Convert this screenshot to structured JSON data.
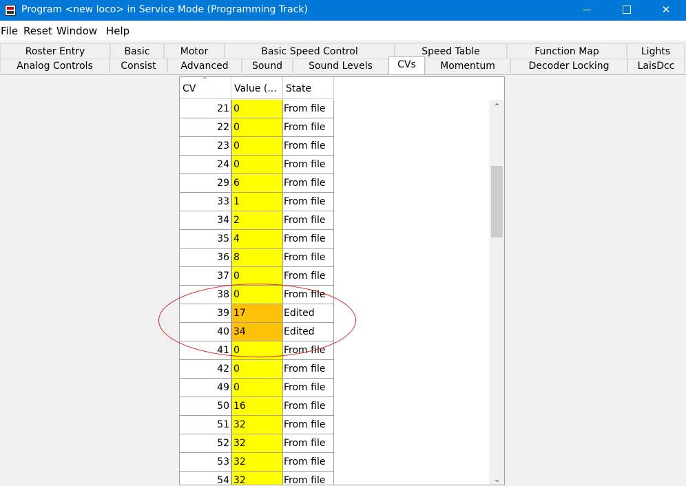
{
  "window": {
    "title": "Program <new loco> in Service Mode (Programming Track)",
    "minimize_glyph": "",
    "close_glyph": "✕"
  },
  "menu": [
    "File",
    "Reset",
    "Window",
    "Help"
  ],
  "tabs_row1": [
    "Roster Entry",
    "Basic",
    "Motor",
    "Basic Speed Control",
    "Speed Table",
    "Function Map",
    "Lights"
  ],
  "tabs_row2": [
    "Analog Controls",
    "Consist",
    "Advanced",
    "Sound",
    "Sound Levels",
    "CVs",
    "Momentum",
    "Decoder Locking",
    "LaisDcc"
  ],
  "active_tab": "CVs",
  "table": {
    "headers": [
      "CV",
      "Value (...",
      "State"
    ],
    "sort_glyph": "^",
    "rows": [
      {
        "cv": "21",
        "value": "0",
        "state": "From file"
      },
      {
        "cv": "22",
        "value": "0",
        "state": "From file"
      },
      {
        "cv": "23",
        "value": "0",
        "state": "From file"
      },
      {
        "cv": "24",
        "value": "0",
        "state": "From file"
      },
      {
        "cv": "29",
        "value": "6",
        "state": "From file"
      },
      {
        "cv": "33",
        "value": "1",
        "state": "From file"
      },
      {
        "cv": "34",
        "value": "2",
        "state": "From file"
      },
      {
        "cv": "35",
        "value": "4",
        "state": "From file"
      },
      {
        "cv": "36",
        "value": "8",
        "state": "From file"
      },
      {
        "cv": "37",
        "value": "0",
        "state": "From file"
      },
      {
        "cv": "38",
        "value": "0",
        "state": "From file"
      },
      {
        "cv": "39",
        "value": "17",
        "state": "Edited"
      },
      {
        "cv": "40",
        "value": "34",
        "state": "Edited"
      },
      {
        "cv": "41",
        "value": "0",
        "state": "From file"
      },
      {
        "cv": "42",
        "value": "0",
        "state": "From file"
      },
      {
        "cv": "49",
        "value": "0",
        "state": "From file"
      },
      {
        "cv": "50",
        "value": "16",
        "state": "From file"
      },
      {
        "cv": "51",
        "value": "32",
        "state": "From file"
      },
      {
        "cv": "52",
        "value": "32",
        "state": "From file"
      },
      {
        "cv": "53",
        "value": "32",
        "state": "From file"
      },
      {
        "cv": "54",
        "value": "32",
        "state": "From file"
      }
    ]
  },
  "colors": {
    "titlebar": "#0078d7",
    "value_from_file": "#ffff00",
    "value_edited": "#ffc107",
    "annotation": "#e02020"
  }
}
